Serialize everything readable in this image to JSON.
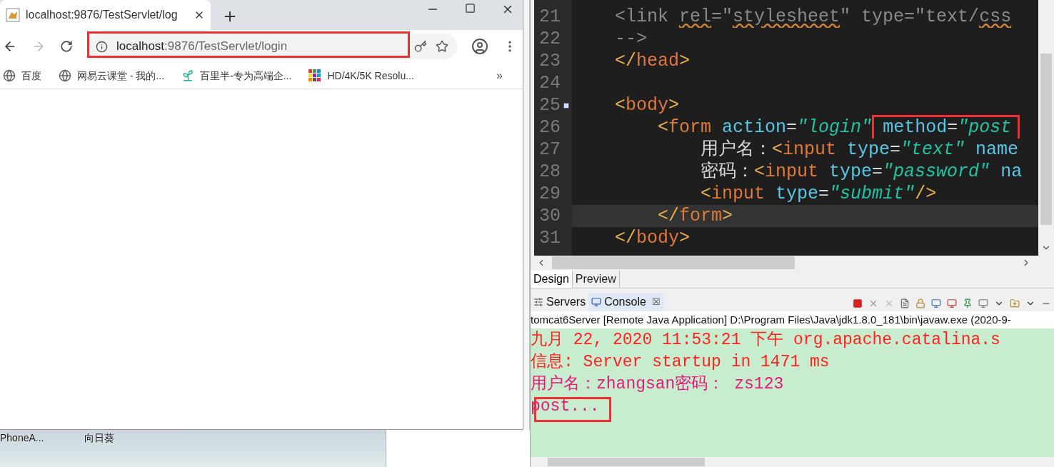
{
  "browser": {
    "tab": {
      "title": "localhost:9876/TestServlet/log"
    },
    "address": {
      "host": "localhost",
      "path": ":9876/TestServlet/login",
      "highlighted": true
    },
    "bookmarks": [
      {
        "kind": "globe",
        "label": "百度"
      },
      {
        "kind": "globe",
        "label": "网易云课堂 - 我的..."
      },
      {
        "kind": "sprout",
        "label": "百里半-专为高端企..."
      },
      {
        "kind": "grid",
        "label": "HD/4K/5K Resolu..."
      }
    ],
    "more": "»"
  },
  "desktop": {
    "icons": [
      "PhoneA...",
      "向日葵"
    ]
  },
  "editor": {
    "lines": [
      {
        "number": "21",
        "current": false,
        "tokens": [
          {
            "kind": "comment",
            "text": "    <link "
          },
          {
            "kind": "squiggle",
            "text": "rel"
          },
          {
            "kind": "comment",
            "text": "=\""
          },
          {
            "kind": "squiggle",
            "text": "stylesheet"
          },
          {
            "kind": "comment",
            "text": "\" type=\"text/"
          },
          {
            "kind": "squiggle",
            "text": "css"
          }
        ]
      },
      {
        "number": "22",
        "current": false,
        "tokens": [
          {
            "kind": "comment",
            "text": "    -->"
          }
        ]
      },
      {
        "number": "23",
        "current": false,
        "tokens": [
          {
            "kind": "punct",
            "text": "    </"
          },
          {
            "kind": "tag",
            "text": "head"
          },
          {
            "kind": "punct",
            "text": ">"
          }
        ]
      },
      {
        "number": "24",
        "current": false
      },
      {
        "number": "25",
        "current": false,
        "folded": true,
        "tokens": [
          {
            "kind": "punct",
            "text": "    <"
          },
          {
            "kind": "tag",
            "text": "body"
          },
          {
            "kind": "punct",
            "text": ">"
          }
        ]
      },
      {
        "number": "26",
        "current": false,
        "tokens": [
          {
            "kind": "punct",
            "text": "        <"
          },
          {
            "kind": "tag",
            "text": "form"
          },
          {
            "kind": "attr",
            "text": " action"
          },
          {
            "kind": "plain",
            "text": "="
          },
          {
            "kind": "string",
            "text": "\"login\""
          },
          {
            "kind": "attr",
            "text": " method",
            "boxed": true
          },
          {
            "kind": "plain",
            "text": "=",
            "boxed": true
          },
          {
            "kind": "string",
            "text": "\"post",
            "boxed": true
          }
        ]
      },
      {
        "number": "27",
        "current": false,
        "tokens": [
          {
            "kind": "plain",
            "text": "            用户名："
          },
          {
            "kind": "punct",
            "text": "<"
          },
          {
            "kind": "tag",
            "text": "input"
          },
          {
            "kind": "attr",
            "text": " type"
          },
          {
            "kind": "plain",
            "text": "="
          },
          {
            "kind": "string",
            "text": "\"text\""
          },
          {
            "kind": "attr",
            "text": " name"
          }
        ]
      },
      {
        "number": "28",
        "current": false,
        "tokens": [
          {
            "kind": "plain",
            "text": "            密码："
          },
          {
            "kind": "punct",
            "text": "<"
          },
          {
            "kind": "tag",
            "text": "input"
          },
          {
            "kind": "attr",
            "text": " type"
          },
          {
            "kind": "plain",
            "text": "="
          },
          {
            "kind": "string",
            "text": "\"password\""
          },
          {
            "kind": "attr",
            "text": " na"
          }
        ]
      },
      {
        "number": "29",
        "current": false,
        "tokens": [
          {
            "kind": "punct",
            "text": "            <"
          },
          {
            "kind": "tag",
            "text": "input"
          },
          {
            "kind": "attr",
            "text": " type"
          },
          {
            "kind": "plain",
            "text": "="
          },
          {
            "kind": "string",
            "text": "\"submit\""
          },
          {
            "kind": "punct",
            "text": "/>"
          }
        ]
      },
      {
        "number": "30",
        "current": true,
        "tokens": [
          {
            "kind": "punct",
            "text": "        </"
          },
          {
            "kind": "tag",
            "text": "form"
          },
          {
            "kind": "punct",
            "text": ">"
          }
        ]
      },
      {
        "number": "31",
        "current": false,
        "tokens": [
          {
            "kind": "punct",
            "text": "    </"
          },
          {
            "kind": "tag",
            "text": "body"
          },
          {
            "kind": "punct",
            "text": ">"
          }
        ]
      }
    ],
    "tabs": [
      {
        "label": "Design",
        "selected": true
      },
      {
        "label": "Preview",
        "selected": false
      }
    ]
  },
  "console": {
    "tabs": [
      {
        "label": "Servers",
        "kind": "servers",
        "selected": false
      },
      {
        "label": "Console",
        "kind": "console",
        "selected": true
      }
    ],
    "close": "☒",
    "header": "tomcat6Server [Remote Java Application] D:\\Program Files\\Java\\jdk1.8.0_181\\bin\\javaw.exe (2020-9-",
    "lines": [
      {
        "kind": "stderr",
        "text": "九月 22, 2020 11:53:21 下午 org.apache.catalina.s",
        "highlighted": false
      },
      {
        "kind": "stderr",
        "text": "信息: Server startup in 1471 ms",
        "highlighted": false
      },
      {
        "kind": "stdout",
        "text": "用户名：zhangsan密码： zs123",
        "highlighted": false
      },
      {
        "kind": "stdout",
        "text": "post...",
        "highlighted": true
      }
    ]
  }
}
